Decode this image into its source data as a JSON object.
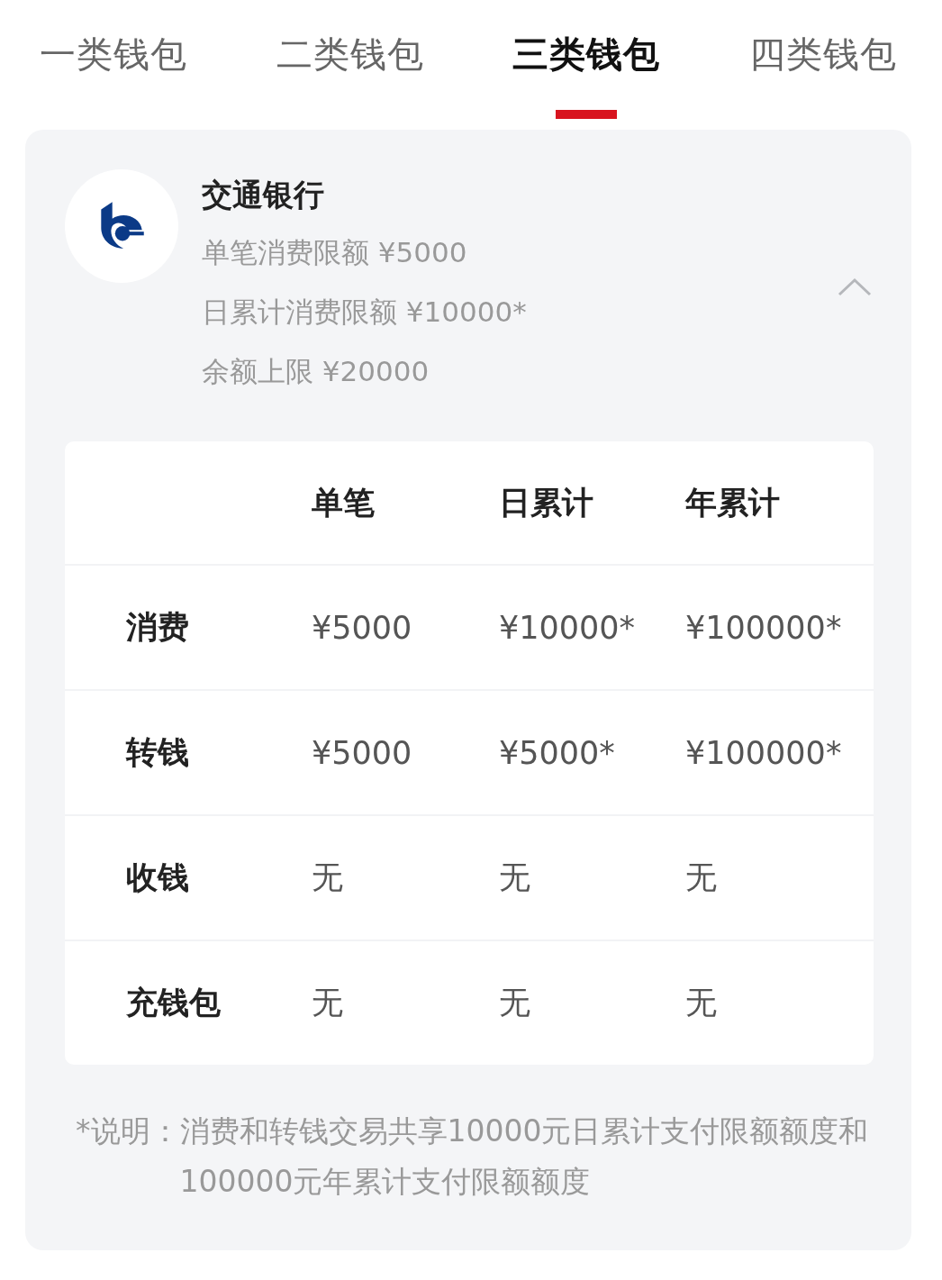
{
  "tabs": [
    {
      "label": "一类钱包",
      "selected": false
    },
    {
      "label": "二类钱包",
      "selected": false
    },
    {
      "label": "三类钱包",
      "selected": true
    },
    {
      "label": "四类钱包",
      "selected": false
    }
  ],
  "bank_card": {
    "name": "交通银行",
    "expanded": true,
    "limits": [
      "单笔消费限额 ¥5000",
      "日累计消费限额 ¥10000*",
      "余额上限 ¥20000"
    ],
    "table": {
      "columns": [
        "单笔",
        "日累计",
        "年累计"
      ],
      "rows": [
        {
          "label": "消费",
          "cells": [
            "¥5000",
            "¥10000*",
            "¥100000*"
          ]
        },
        {
          "label": "转钱",
          "cells": [
            "¥5000",
            "¥5000*",
            "¥100000*"
          ]
        },
        {
          "label": "收钱",
          "cells": [
            "无",
            "无",
            "无"
          ]
        },
        {
          "label": "充钱包",
          "cells": [
            "无",
            "无",
            "无"
          ]
        }
      ]
    },
    "note": {
      "label": "*说明：",
      "text": "消费和转钱交易共享10000元日累计支付限额额度和100000元年累计支付限额额度"
    }
  }
}
